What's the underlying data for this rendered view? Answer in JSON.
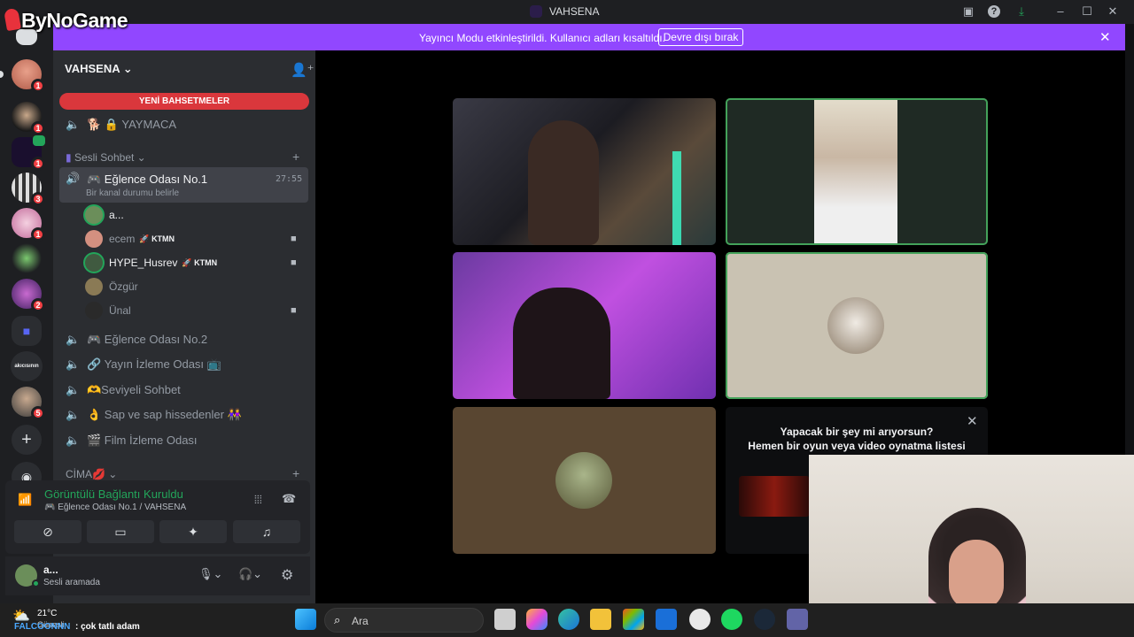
{
  "window": {
    "title": "VAHSENA",
    "logo": "ByNoGame"
  },
  "banner": {
    "text": "Yayıncı Modu etkinleştirildi. Kullanıcı adları kısaltıldı.",
    "button": "Devre dışı bırak"
  },
  "rail": {
    "badges": [
      "1",
      "1",
      "1",
      "3",
      "1",
      "2",
      "5"
    ],
    "server_label": "akıcısının"
  },
  "sidebar": {
    "server_name": "VAHSENA",
    "new_mentions": "YENİ BAHSETMELER",
    "channels_top": [
      {
        "label": "🐕 🔒 YAYMACA"
      }
    ],
    "category_voice": "Sesli Sohbet",
    "active_channel": {
      "label": "🎮 Eğlence Odası No.1",
      "status": "Bir kanal durumu belirle",
      "timer": "27:55"
    },
    "users": [
      {
        "name": "a...",
        "tag": ""
      },
      {
        "name": "ecem",
        "tag": "KTMN"
      },
      {
        "name": "HYPE_Husrev",
        "tag": "KTMN"
      },
      {
        "name": "Özgür",
        "tag": ""
      },
      {
        "name": "Ünal",
        "tag": ""
      }
    ],
    "channels": [
      {
        "label": "🎮 Eğlence Odası No.2"
      },
      {
        "label": "🔗 Yayın İzleme Odası 📺"
      },
      {
        "label": "🫶Seviyeli Sohbet"
      },
      {
        "label": "👌 Sap ve sap hissedenler 👭"
      },
      {
        "label": "🎬 Film İzleme Odası"
      }
    ],
    "category_2": "CİMA💋"
  },
  "voice": {
    "status": "Görüntülü Bağlantı Kuruldu",
    "channel": "🎮 Eğlence Odası No.1 / VAHSENA"
  },
  "userpanel": {
    "name": "a...",
    "status": "Sesli aramada"
  },
  "stage": {
    "hint_line1": "Yapacak bir şey mi arıyorsun?",
    "hint_line2": "Hemen bir oyun veya video oynatma listesi"
  },
  "taskbar": {
    "weather_temp": "21°C",
    "weather_label": "Güneşli",
    "search_placeholder": "Ara",
    "now_playing_user": "FALCOONNN",
    "now_playing_text": "çok tatlı adam"
  },
  "colors": {
    "accent": "#9147ff",
    "speaking": "#43a25a",
    "alert": "#da373c",
    "connected": "#23a55a"
  },
  "icons": [
    "discord-logo-icon",
    "add-friend-icon",
    "speaker-icon",
    "camera-icon",
    "signal-icon",
    "hangup-icon",
    "mic-icon",
    "headset-icon",
    "gear-icon",
    "search-icon",
    "windows-start-icon"
  ]
}
